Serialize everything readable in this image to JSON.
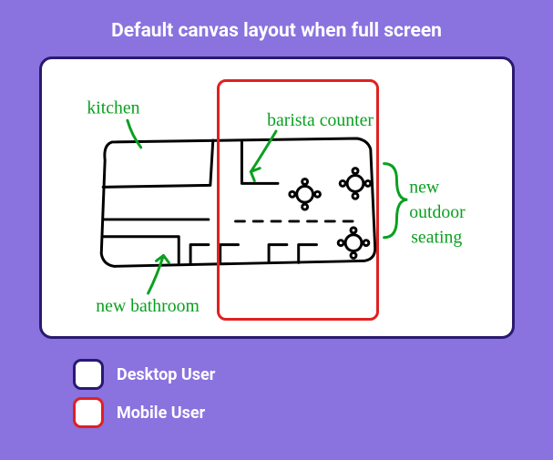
{
  "title": "Default canvas layout when full screen",
  "annotations": {
    "kitchen": "kitchen",
    "barista": "barista counter",
    "bathroom": "new bathroom",
    "outdoor": "new outdoor seating"
  },
  "legend": {
    "desktop": "Desktop User",
    "mobile": "Mobile User"
  },
  "colors": {
    "background": "#8a72df",
    "desktop_border": "#2a1a6e",
    "mobile_border": "#e02020",
    "annotation_ink": "#0aa020",
    "sketch_ink": "#000000"
  }
}
